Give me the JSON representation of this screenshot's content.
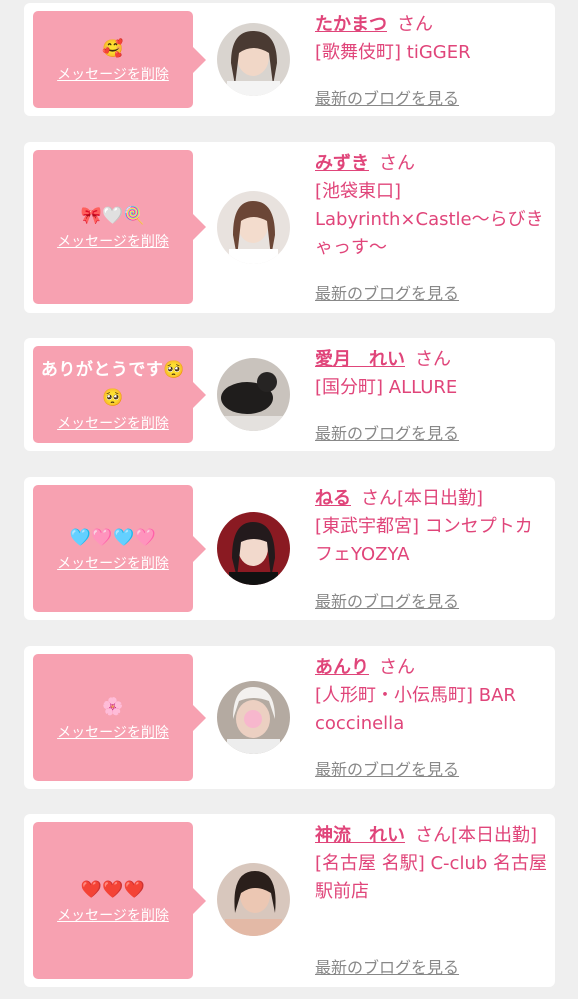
{
  "colors": {
    "accent": "#e0457a",
    "bubble": "#f7a1b1",
    "link_gray": "#888888"
  },
  "delete_label": "メッセージを削除",
  "blog_label": "最新のブログを見る",
  "honorific": "さん",
  "items": [
    {
      "message": "🥰",
      "name": "たかまつ",
      "status": "",
      "shop": "[歌舞伎町] tiGGER"
    },
    {
      "message": "🎀🤍🍭",
      "name": "みずき",
      "status": "",
      "shop": "[池袋東口] Labyrinth×Castle〜らびきゃっす〜"
    },
    {
      "message": "ありがとうです🥺🥺",
      "name": "愛月　れい",
      "status": "",
      "shop": "[国分町] ALLURE"
    },
    {
      "message": "🩵🩷🩵🩷",
      "name": "ねる",
      "status": "[本日出勤]",
      "shop": "[東武宇都宮] コンセプトカフェYOZYA"
    },
    {
      "message": "🌸",
      "name": "あんり",
      "status": "",
      "shop": "[人形町・小伝馬町] BAR coccinella"
    },
    {
      "message": "❤️❤️❤️",
      "name": "神流　れい",
      "status": "[本日出勤]",
      "shop": "[名古屋 名駅] C-club 名古屋駅前店"
    }
  ]
}
